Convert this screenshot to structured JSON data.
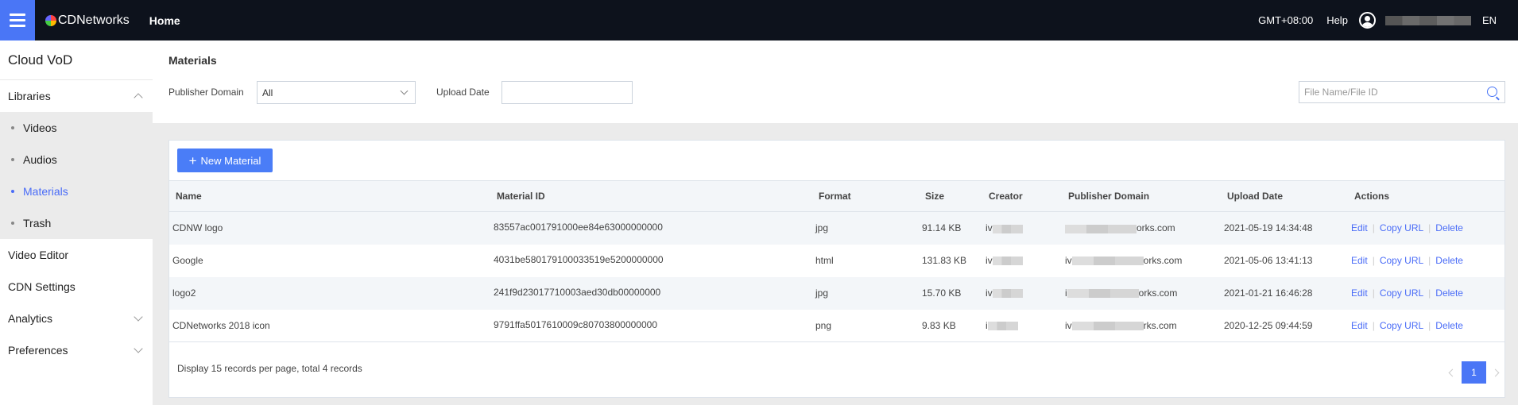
{
  "topbar": {
    "brand": "CDNetworks",
    "home": "Home",
    "timezone": "GMT+08:00",
    "help": "Help",
    "language": "EN"
  },
  "sidebar": {
    "title": "Cloud VoD",
    "libraries": "Libraries",
    "sub_items": [
      "Videos",
      "Audios",
      "Materials",
      "Trash"
    ],
    "video_editor": "Video Editor",
    "cdn_settings": "CDN Settings",
    "analytics": "Analytics",
    "preferences": "Preferences"
  },
  "filters": {
    "page_title": "Materials",
    "publisher_domain_label": "Publisher Domain",
    "publisher_domain_value": "All",
    "upload_date_label": "Upload Date",
    "search_placeholder": "File Name/File ID"
  },
  "table": {
    "new_button": "New Material",
    "columns": [
      "Name",
      "Material ID",
      "Format",
      "Size",
      "Creator",
      "Publisher Domain",
      "Upload Date",
      "Actions"
    ],
    "rows": [
      {
        "name": "CDNW logo",
        "id": "83557ac001791000ee84e63000000000",
        "format": "jpg",
        "size": "91.14 KB",
        "creator_prefix": "iv",
        "domain_prefix": "",
        "domain_suffix": "orks.com",
        "date": "2021-05-19 14:34:48"
      },
      {
        "name": "Google",
        "id": "4031be580179100033519e5200000000",
        "format": "html",
        "size": "131.83 KB",
        "creator_prefix": "iv",
        "domain_prefix": "iv",
        "domain_suffix": "orks.com",
        "date": "2021-05-06 13:41:13"
      },
      {
        "name": "logo2",
        "id": "241f9d23017710003aed30db00000000",
        "format": "jpg",
        "size": "15.70 KB",
        "creator_prefix": "iv",
        "domain_prefix": "i",
        "domain_suffix": "orks.com",
        "date": "2021-01-21 16:46:28"
      },
      {
        "name": "CDNetworks 2018 icon",
        "id": "9791ffa5017610009c80703800000000",
        "format": "png",
        "size": "9.83 KB",
        "creator_prefix": "i",
        "domain_prefix": "iv",
        "domain_suffix": "rks.com",
        "date": "2020-12-25 09:44:59"
      }
    ],
    "actions": {
      "edit": "Edit",
      "copy_url": "Copy URL",
      "delete": "Delete"
    },
    "footer": "Display 15 records per page, total 4 records",
    "current_page": "1"
  }
}
